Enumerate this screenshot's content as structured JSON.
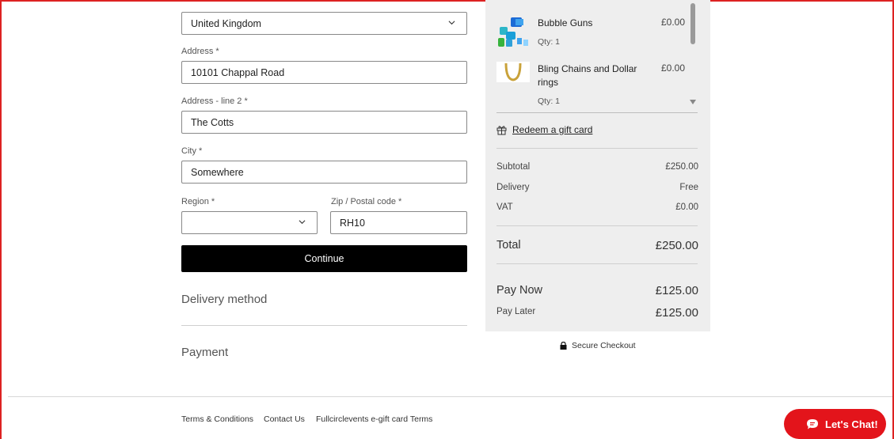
{
  "form": {
    "country_value": "United Kingdom",
    "address_label": "Address *",
    "address_value": "10101 Chappal Road",
    "address2_label": "Address - line 2 *",
    "address2_value": "The Cotts",
    "city_label": "City *",
    "city_value": "Somewhere",
    "region_label": "Region *",
    "region_value": "",
    "zip_label": "Zip / Postal code *",
    "zip_value": "RH10",
    "continue_label": "Continue"
  },
  "sections": {
    "delivery_method": "Delivery method",
    "payment": "Payment"
  },
  "cart": {
    "items": [
      {
        "name": "Bubble Guns",
        "qty": "Qty: 1",
        "price": "£0.00"
      },
      {
        "name": "Bling Chains and Dollar rings",
        "qty": "Qty: 1",
        "price": "£0.00"
      }
    ],
    "gift_card_link": "Redeem a gift card",
    "subtotal_label": "Subtotal",
    "subtotal_value": "£250.00",
    "delivery_label": "Delivery",
    "delivery_value": "Free",
    "vat_label": "VAT",
    "vat_value": "£0.00",
    "total_label": "Total",
    "total_value": "£250.00",
    "pay_now_label": "Pay Now",
    "pay_now_value": "£125.00",
    "pay_later_label": "Pay Later",
    "pay_later_value": "£125.00",
    "secure_label": "Secure Checkout"
  },
  "footer": {
    "terms": "Terms & Conditions",
    "contact": "Contact Us",
    "gift_terms": "Fullcirclevents e-gift card Terms"
  },
  "chat": {
    "label": "Let's Chat!"
  },
  "colors": {
    "accent": "#e3141b",
    "button": "#000000",
    "summary_bg": "#eeeeee"
  },
  "icons": [
    "chevron-down-icon",
    "gift-icon",
    "lock-icon",
    "chat-bubble-icon"
  ]
}
